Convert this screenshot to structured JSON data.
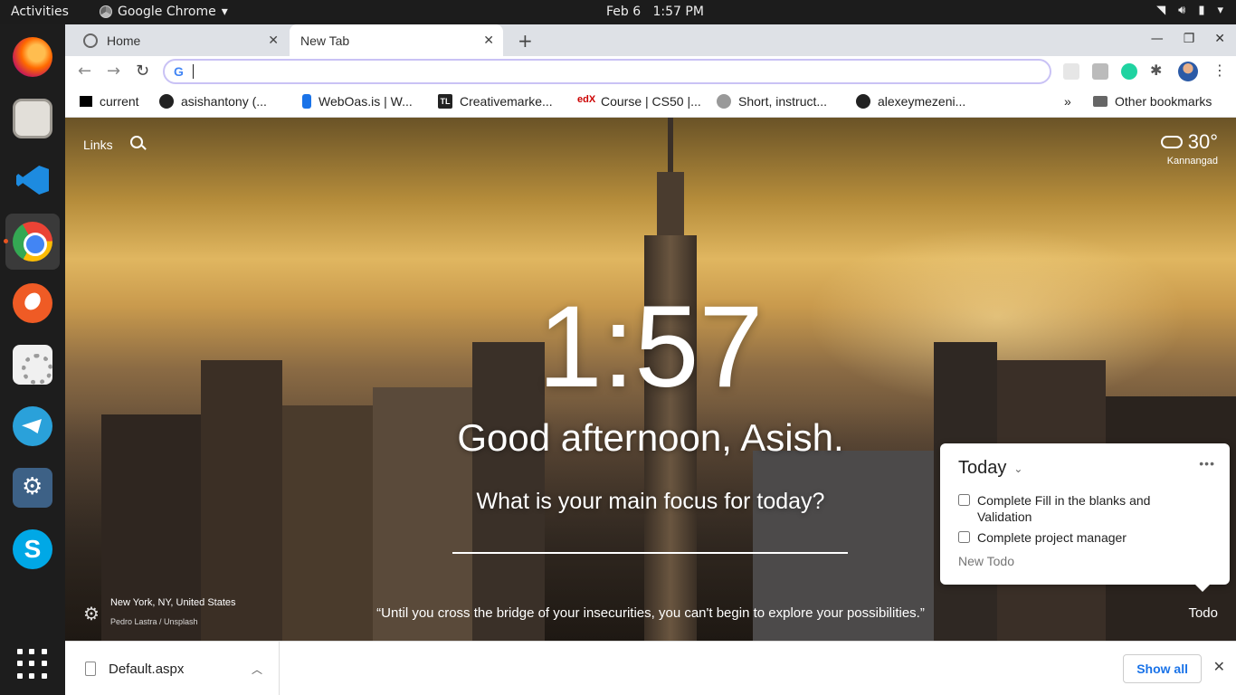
{
  "topbar": {
    "activities": "Activities",
    "app_name": "Google Chrome",
    "date": "Feb 6",
    "time": "1:57 PM"
  },
  "dock": {
    "apps": [
      "firefox-icon",
      "files-icon",
      "vscode-icon",
      "chrome-icon",
      "postman-icon",
      "settings-icon",
      "telegram-icon",
      "mysql-workbench-icon",
      "skype-icon",
      "show-apps-icon"
    ],
    "active": "chrome-icon",
    "skype_letter": "S"
  },
  "tabs": [
    {
      "label": "Home",
      "active": false
    },
    {
      "label": "New Tab",
      "active": true
    }
  ],
  "omnibox": {
    "value": "",
    "google_letter": "G"
  },
  "bookmarks": [
    {
      "label": "current",
      "icon": "triangle-icon"
    },
    {
      "label": "asishantony (...",
      "icon": "github-icon"
    },
    {
      "label": "WebOas.is | W...",
      "icon": "weboas-icon"
    },
    {
      "label": "Creativemarke...",
      "icon": "tl-icon",
      "icon_text": "TL"
    },
    {
      "label": "Course | CS50 |...",
      "icon": "edx-icon",
      "icon_text": "edX"
    },
    {
      "label": "Short, instruct...",
      "icon": "ninja-icon"
    },
    {
      "label": "alexeymezeni...",
      "icon": "github-icon"
    }
  ],
  "bookmarks_overflow": "»",
  "other_bookmarks": "Other bookmarks",
  "momentum": {
    "links_label": "Links",
    "weather": {
      "temp": "30°",
      "location": "Kannangad"
    },
    "time": "1:57",
    "greeting": "Good afternoon, Asish.",
    "focus_question": "What is your main focus for today?",
    "photo_location": "New York, NY, United States",
    "photo_credit": "Pedro Lastra / Unsplash",
    "quote": "“Until you cross the bridge of your insecurities, you can't begin to explore your possibilities.”",
    "todo_link": "Todo"
  },
  "todo": {
    "heading": "Today",
    "items": [
      {
        "text": "Complete Fill in the blanks and Validation",
        "done": false
      },
      {
        "text": "Complete project manager",
        "done": false
      }
    ],
    "new_placeholder": "New Todo"
  },
  "downloads": {
    "file": "Default.aspx",
    "show_all": "Show all"
  }
}
